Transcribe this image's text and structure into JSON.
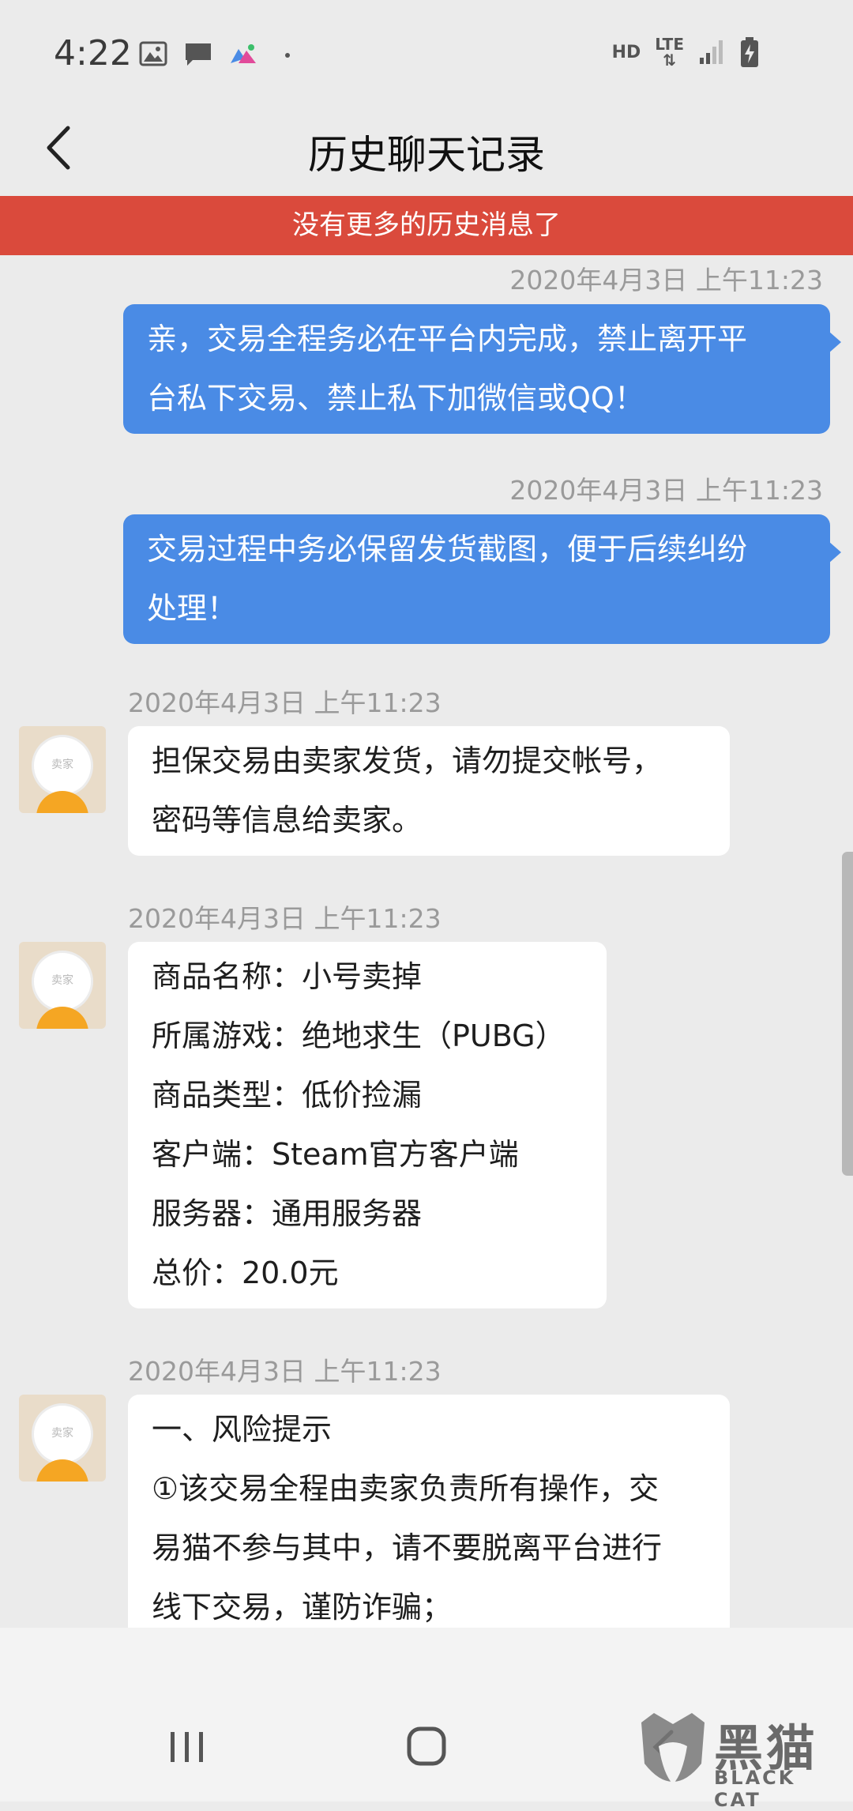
{
  "status_bar": {
    "time": "4:22",
    "icons_left": [
      "image-icon",
      "message-icon",
      "gallery-icon",
      "dot"
    ],
    "hd": "HD",
    "lte": "LTE",
    "icons_right": [
      "signal-icon",
      "battery-charging-icon"
    ]
  },
  "header": {
    "title": "历史聊天记录"
  },
  "banner": {
    "text": "没有更多的历史消息了"
  },
  "messages": [
    {
      "side": "right",
      "timestamp": "2020年4月3日 上午11:23",
      "lines": [
        "亲，交易全程务必在平台内完成，禁止离开平",
        "台私下交易、禁止私下加微信或QQ！"
      ]
    },
    {
      "side": "right",
      "timestamp": "2020年4月3日 上午11:23",
      "lines": [
        "交易过程中务必保留发货截图，便于后续纠纷",
        "处理！"
      ]
    },
    {
      "side": "left",
      "timestamp": "2020年4月3日 上午11:23",
      "lines": [
        "担保交易由卖家发货，请勿提交帐号，",
        "密码等信息给卖家。"
      ]
    },
    {
      "side": "left",
      "timestamp": "2020年4月3日 上午11:23",
      "lines": [
        "商品名称：小号卖掉",
        "所属游戏：绝地求生（PUBG）",
        "商品类型：低价捡漏",
        "客户端：Steam官方客户端",
        "服务器：通用服务器",
        "总价：20.0元"
      ]
    },
    {
      "side": "left",
      "timestamp": "2020年4月3日 上午11:23",
      "lines": [
        "一、风险提示",
        "①该交易全程由卖家负责所有操作，交",
        "易猫不参与其中，请不要脱离平台进行",
        "线下交易，谨防诈骗；"
      ]
    }
  ],
  "avatar_label": "卖家",
  "watermark": {
    "title": "黑猫",
    "subtitle": "BLACK CAT"
  },
  "colors": {
    "outgoing_bubble": "#4a8be5",
    "banner": "#da4a3c",
    "background": "#ebebeb"
  }
}
